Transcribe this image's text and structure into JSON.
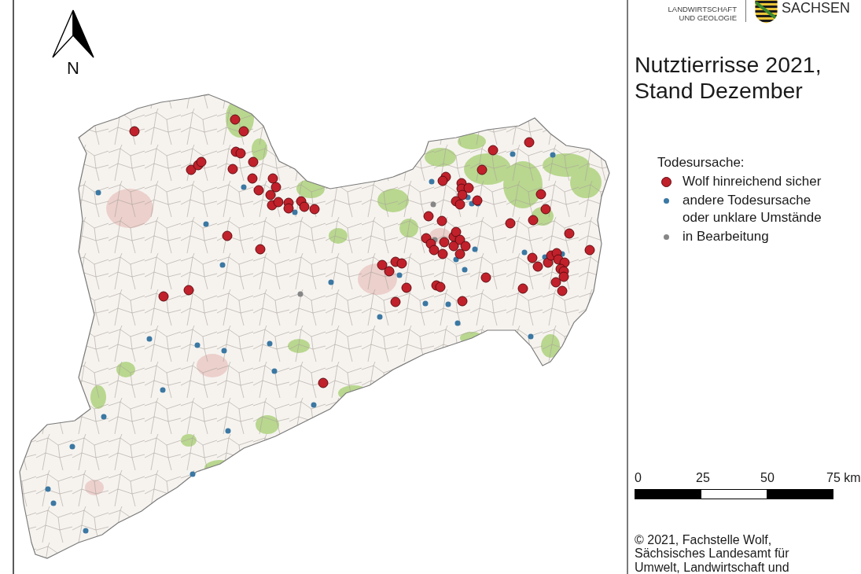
{
  "header": {
    "agency_name": "LANDWIRTSCHAFT UND GEOLOGIE",
    "state_name": "SACHSEN"
  },
  "map": {
    "north_label": "N"
  },
  "title": "Nutztierrisse 2021, Stand Dezember",
  "legend": {
    "heading": "Todesursache:",
    "items": [
      {
        "label": "Wolf hinreichend sicher",
        "color": "#c0212b",
        "kind": "large"
      },
      {
        "label": "andere Todesursache oder unklare Umstände",
        "color": "#3b78a3",
        "kind": "small"
      },
      {
        "label": "in Bearbeitung",
        "color": "#868686",
        "kind": "small"
      }
    ]
  },
  "scale_bar": {
    "labels": [
      "0",
      "25",
      "50",
      "75 km"
    ]
  },
  "credit": "© 2021, Fachstelle Wolf, Sächsisches Landesamt für Umwelt, Landwirtschaft und"
}
